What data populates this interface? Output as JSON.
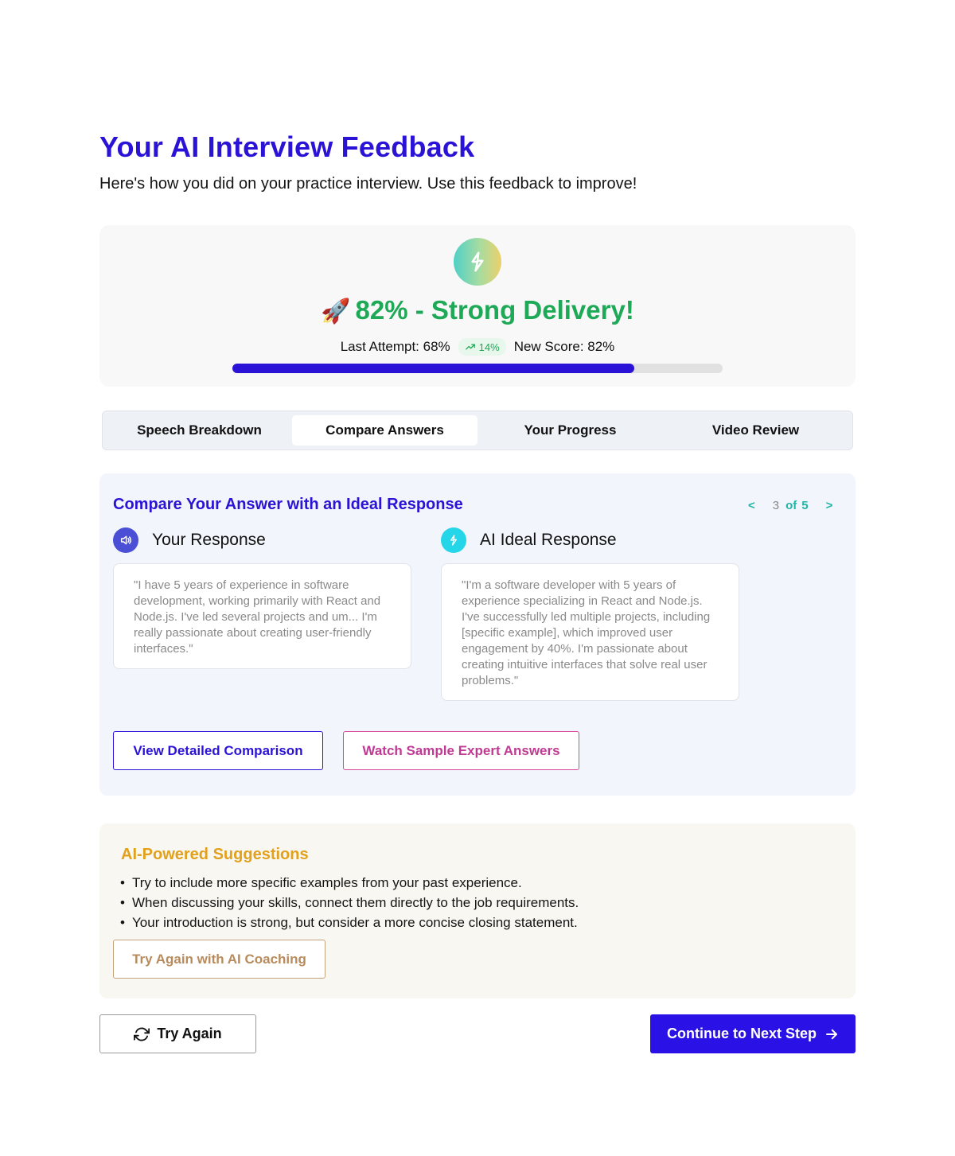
{
  "header": {
    "title": "Your AI Interview Feedback",
    "subtitle": "Here's how you did on your practice interview. Use this feedback to improve!"
  },
  "score": {
    "icon": "lightning-icon",
    "emoji": "🚀",
    "headline": "82% - Strong Delivery!",
    "last_attempt": "Last Attempt: 68%",
    "delta": "14%",
    "new_score": "New Score: 82%",
    "progress_fraction": 0.82,
    "colors": {
      "accent": "#2a12d6",
      "success": "#1ea956"
    }
  },
  "tabs": [
    {
      "label": "Speech Breakdown",
      "active": false
    },
    {
      "label": "Compare Answers",
      "active": true
    },
    {
      "label": "Your Progress",
      "active": false
    },
    {
      "label": "Video Review",
      "active": false
    }
  ],
  "compare": {
    "title": "Compare Your Answer with an Ideal Response",
    "pager": {
      "prev": "<",
      "current": "3",
      "of": "of",
      "total": "5",
      "next": ">"
    },
    "your_response": {
      "label": "Your Response",
      "icon": "speaker-icon",
      "text": "\"I have 5 years of experience in software development, working primarily with React and Node.js. I've led several projects and um... I'm really passionate about creating user-friendly interfaces.\""
    },
    "ai_response": {
      "label": "AI Ideal Response",
      "icon": "lightning-icon",
      "text": "\"I'm a software developer with 5 years of experience specializing in React and Node.js. I've successfully led multiple projects, including [specific example], which improved user engagement by 40%. I'm passionate about creating intuitive interfaces that solve real user problems.\""
    },
    "view_detailed_label": "View Detailed Comparison",
    "watch_sample_label": "Watch Sample Expert Answers"
  },
  "suggestions": {
    "title": "AI-Powered Suggestions",
    "items": [
      "Try to include more specific examples from your past experience.",
      "When discussing your skills, connect them directly to the job requirements.",
      "Your introduction is strong, but consider a more concise closing statement."
    ],
    "coaching_label": "Try Again with AI Coaching"
  },
  "footer": {
    "try_again_label": "Try Again",
    "try_again_icon": "refresh-icon",
    "continue_label": "Continue to Next Step",
    "continue_icon": "arrow-right-icon"
  }
}
